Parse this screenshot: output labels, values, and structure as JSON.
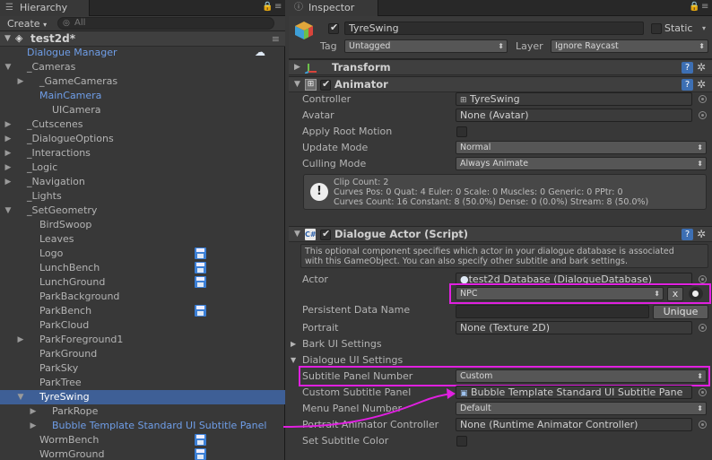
{
  "hierarchy": {
    "tab": "Hierarchy",
    "create": "Create",
    "search_placeholder": "All",
    "scene": "test2d*",
    "items": [
      {
        "label": "Dialogue Manager"
      },
      {
        "label": "_Cameras"
      },
      {
        "label": "_GameCameras"
      },
      {
        "label": "MainCamera"
      },
      {
        "label": "UICamera"
      },
      {
        "label": "_Cutscenes"
      },
      {
        "label": "_DialogueOptions"
      },
      {
        "label": "_Interactions"
      },
      {
        "label": "_Logic"
      },
      {
        "label": "_Navigation"
      },
      {
        "label": "_Lights"
      },
      {
        "label": "_SetGeometry"
      },
      {
        "label": "BirdSwoop"
      },
      {
        "label": "Leaves"
      },
      {
        "label": "Logo"
      },
      {
        "label": "LunchBench"
      },
      {
        "label": "LunchGround"
      },
      {
        "label": "ParkBackground"
      },
      {
        "label": "ParkBench"
      },
      {
        "label": "ParkCloud"
      },
      {
        "label": "ParkForeground1"
      },
      {
        "label": "ParkGround"
      },
      {
        "label": "ParkSky"
      },
      {
        "label": "ParkTree"
      },
      {
        "label": "TyreSwing"
      },
      {
        "label": "ParkRope"
      },
      {
        "label": "Bubble Template Standard UI Subtitle Panel"
      },
      {
        "label": "WormBench"
      },
      {
        "label": "WormGround"
      }
    ]
  },
  "inspector": {
    "tab": "Inspector",
    "object_name": "TyreSwing",
    "static_label": "Static",
    "tag_label": "Tag",
    "tag_value": "Untagged",
    "layer_label": "Layer",
    "layer_value": "Ignore Raycast",
    "transform": {
      "title": "Transform"
    },
    "animator": {
      "title": "Animator",
      "controller_label": "Controller",
      "controller_value": "TyreSwing",
      "avatar_label": "Avatar",
      "avatar_value": "None (Avatar)",
      "root_motion_label": "Apply Root Motion",
      "update_mode_label": "Update Mode",
      "update_mode_value": "Normal",
      "culling_mode_label": "Culling Mode",
      "culling_mode_value": "Always Animate",
      "info_1": "Clip Count: 2",
      "info_2": "Curves Pos: 0 Quat: 4 Euler: 0 Scale: 0 Muscles: 0 Generic: 0 PPtr: 0",
      "info_3": "Curves Count: 16 Constant: 8 (50.0%) Dense: 0 (0.0%) Stream: 8 (50.0%)"
    },
    "dialogue_actor": {
      "title": "Dialogue Actor (Script)",
      "desc_1": "This optional component specifies which actor in your dialogue database is associated",
      "desc_2": "with this GameObject. You can also specify other subtitle and bark settings.",
      "actor_label": "Actor",
      "actor_db": "test2d Database (DialogueDatabase)",
      "actor_value": "NPC",
      "clear_button": "x",
      "persistent_label": "Persistent Data Name",
      "unique_button": "Unique",
      "portrait_label": "Portrait",
      "portrait_value": "None (Texture 2D)",
      "bark_label": "Bark UI Settings",
      "dialogue_ui_label": "Dialogue UI Settings",
      "subtitle_panel_label": "Subtitle Panel Number",
      "subtitle_panel_value": "Custom",
      "custom_panel_label": "Custom Subtitle Panel",
      "custom_panel_value": "Bubble Template Standard UI Subtitle Pane",
      "menu_panel_label": "Menu Panel Number",
      "menu_panel_value": "Default",
      "portrait_anim_label": "Portrait Animator Controller",
      "portrait_anim_value": "None (Runtime Animator Controller)",
      "subtitle_color_label": "Set Subtitle Color"
    }
  },
  "colors": {
    "highlight": "#e020e0",
    "prefab_text": "#6f9ee8",
    "selection": "#3e5f96"
  }
}
